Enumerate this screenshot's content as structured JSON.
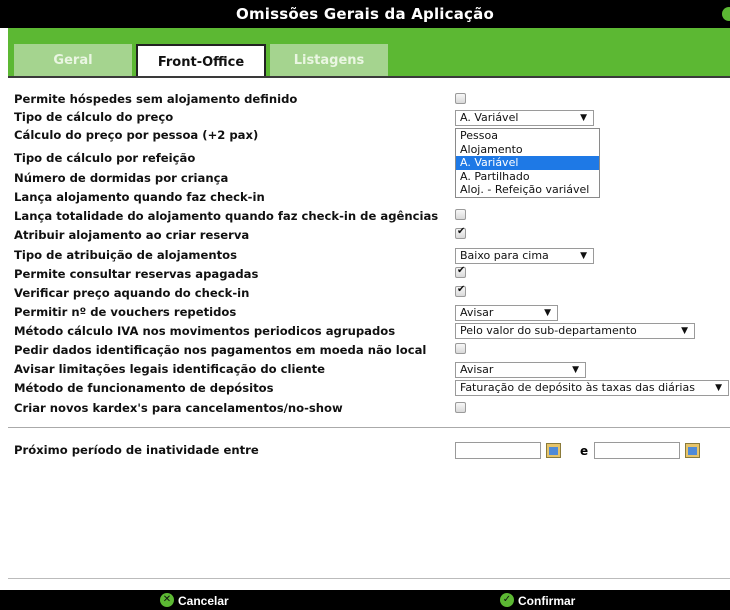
{
  "window": {
    "title": "Omissões Gerais da Aplicação"
  },
  "tabs": [
    {
      "label": "Geral",
      "active": false
    },
    {
      "label": "Front-Office",
      "active": true
    },
    {
      "label": "Listagens",
      "active": false
    }
  ],
  "settings": [
    {
      "label": "Permite hóspedes sem alojamento definido",
      "control": "checkbox",
      "checked": false
    },
    {
      "label": "Tipo de cálculo do preço",
      "control": "select",
      "value": "A. Variável"
    },
    {
      "label": "Cálculo do preço por pessoa (+2 pax)"
    },
    {
      "label": "Tipo de cálculo por refeição"
    },
    {
      "label": "Número de dormidas por criança"
    },
    {
      "label": "Lança alojamento quando faz check-in"
    },
    {
      "label": "Lança totalidade do alojamento quando faz check-in de agências",
      "control": "checkbox",
      "checked": false
    },
    {
      "label": "Atribuir alojamento ao criar reserva",
      "control": "checkbox",
      "checked": true
    },
    {
      "label": "Tipo de atribuição de alojamentos",
      "control": "select",
      "value": "Baixo para cima"
    },
    {
      "label": "Permite consultar reservas apagadas",
      "control": "checkbox",
      "checked": true
    },
    {
      "label": "Verificar preço aquando do check-in",
      "control": "checkbox",
      "checked": true
    },
    {
      "label": "Permitir nº de vouchers repetidos",
      "control": "select",
      "value": "Avisar"
    },
    {
      "label": "Método cálculo IVA nos movimentos periodicos agrupados",
      "control": "select",
      "value": "Pelo valor do sub-departamento"
    },
    {
      "label": "Pedir dados identificação nos pagamentos em moeda não local",
      "control": "checkbox",
      "checked": false
    },
    {
      "label": "Avisar limitações legais identificação do cliente",
      "control": "select",
      "value": "Avisar"
    },
    {
      "label": "Método de funcionamento de depósitos",
      "control": "select",
      "value": "Faturação de depósito às taxas das diárias"
    },
    {
      "label": "Criar novos kardex's para cancelamentos/no-show",
      "control": "checkbox",
      "checked": false
    }
  ],
  "price_calc_dropdown": {
    "options": [
      "Pessoa",
      "Alojamento",
      "A. Variável",
      "A. Partilhado",
      "Aloj. - Refeição variável"
    ],
    "selected": "A. Variável"
  },
  "inactivity": {
    "label": "Próximo período de inatividade entre",
    "from": "",
    "separator": "e",
    "to": ""
  },
  "footer": {
    "cancel_label": "Cancelar",
    "confirm_label": "Confirmar"
  },
  "colors": {
    "accent": "#5cb833",
    "titlebar": "#000000",
    "tab_inactive": "#a5d48f",
    "highlight": "#1e79e6"
  },
  "icons": {
    "close": "close-icon",
    "cancel": "x-circle-icon",
    "confirm": "check-circle-icon",
    "calendar": "calendar-icon",
    "dropdown": "chevron-down-icon"
  }
}
